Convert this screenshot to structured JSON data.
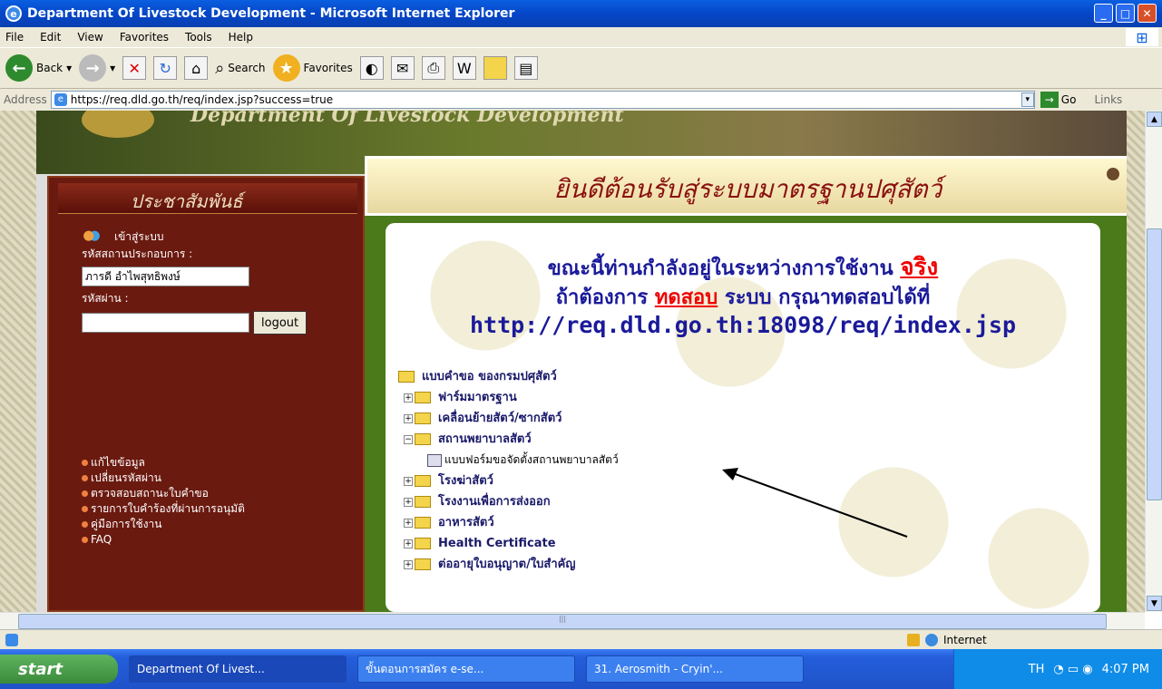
{
  "window": {
    "title": "Department Of Livestock Development - Microsoft Internet Explorer"
  },
  "menu": [
    "File",
    "Edit",
    "View",
    "Favorites",
    "Tools",
    "Help"
  ],
  "toolbar": {
    "back": "Back",
    "search": "Search",
    "favorites": "Favorites"
  },
  "address": {
    "label": "Address",
    "url": "https://req.dld.go.th/req/index.jsp?success=true",
    "go": "Go",
    "links": "Links"
  },
  "banner": {
    "text": "Department Of Livestock Development"
  },
  "sidebar": {
    "title": "ประชาสัมพันธ์",
    "login_label": "เข้าสู่ระบบ",
    "operator_label": "รหัสสถานประกอบการ :",
    "operator_value": "ภารดี อำไพสุทธิพงษ์",
    "password_label": "รหัสผ่าน :",
    "logout": "logout",
    "menu": [
      "แก้ไขข้อมูล",
      "เปลี่ยนรหัสผ่าน",
      "ตรวจสอบสถานะใบคำขอ",
      "รายการใบคำร้องที่ผ่านการอนุมัติ",
      "คู่มือการใช้งาน",
      "FAQ"
    ]
  },
  "welcome": "ยินดีต้อนรับสู่ระบบมาตรฐานปศุสัตว์",
  "notice": {
    "line1a": "ขณะนี้ท่านกำลังอยู่ในระหว่างการใช้งาน",
    "line1b": "จริง",
    "line2a": "ถ้าต้องการ",
    "line2b": "ทดสอบ",
    "line2c": "ระบบ กรุณาทดสอบได้ที่",
    "line3": "http://req.dld.go.th:18098/req/index.jsp"
  },
  "tree": {
    "root": "แบบคำขอ ของกรมปศุสัตว์",
    "items": [
      "ฟาร์มมาตรฐาน",
      "เคลื่อนย้ายสัตว์/ซากสัตว์",
      "สถานพยาบาลสัตว์",
      "โรงฆ่าสัตว์",
      "โรงงานเพื่อการส่งออก",
      "อาหารสัตว์",
      "Health Certificate",
      "ต่ออายุใบอนุญาต/ใบสำคัญ"
    ],
    "form": "แบบฟอร์มขอจัดตั้งสถานพยาบาลสัตว์"
  },
  "status": {
    "zone": "Internet"
  },
  "taskbar": {
    "start": "start",
    "tasks": [
      "Department Of Livest...",
      "ขั้นตอนการสมัคร e-se...",
      "31. Aerosmith - Cryin'..."
    ],
    "lang": "TH",
    "clock": "4:07 PM"
  }
}
